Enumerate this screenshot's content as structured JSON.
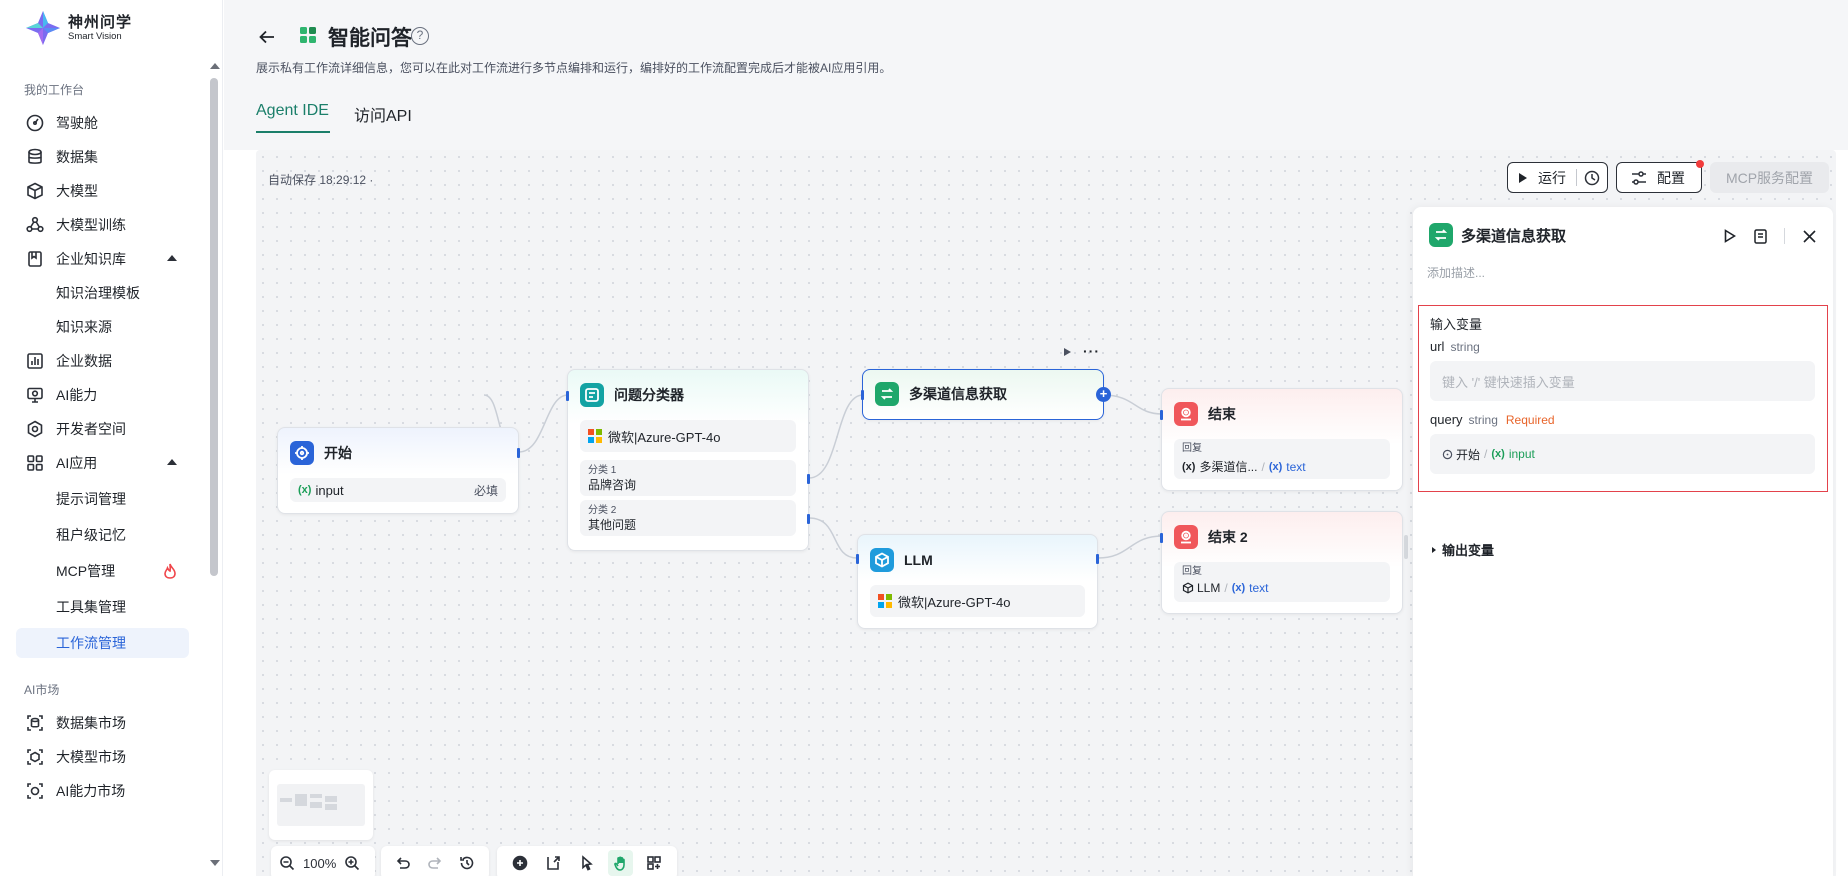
{
  "brand": {
    "name_cn": "神州问学",
    "name_en": "Smart Vision"
  },
  "sidebar": {
    "sections": [
      {
        "title": "我的工作台"
      },
      {
        "title": "AI市场"
      }
    ],
    "items": [
      {
        "label": "驾驶舱",
        "icon": "dashboard-icon"
      },
      {
        "label": "数据集",
        "icon": "database-icon"
      },
      {
        "label": "大模型",
        "icon": "cube-icon"
      },
      {
        "label": "大模型训练",
        "icon": "training-icon"
      },
      {
        "label": "企业知识库",
        "icon": "knowledge-icon",
        "expanded": true
      },
      {
        "label": "知识治理模板"
      },
      {
        "label": "知识来源"
      },
      {
        "label": "企业数据",
        "icon": "chart-icon"
      },
      {
        "label": "AI能力",
        "icon": "ai-ability-icon"
      },
      {
        "label": "开发者空间",
        "icon": "developer-icon"
      },
      {
        "label": "AI应用",
        "icon": "apps-icon",
        "expanded": true
      },
      {
        "label": "提示词管理"
      },
      {
        "label": "租户级记忆"
      },
      {
        "label": "MCP管理",
        "badge": "fire-icon"
      },
      {
        "label": "工具集管理"
      },
      {
        "label": "工作流管理",
        "active": true
      },
      {
        "label": "数据集市场",
        "icon": "dataset-market-icon"
      },
      {
        "label": "大模型市场",
        "icon": "model-market-icon"
      },
      {
        "label": "AI能力市场",
        "icon": "ability-market-icon"
      }
    ]
  },
  "header": {
    "title": "智能问答",
    "help": "?",
    "description": "展示私有工作流详细信息，您可以在此对工作流进行多节点编排和运行，编排好的工作流配置完成后才能被AI应用引用。",
    "tabs": [
      {
        "label": "Agent IDE",
        "active": true
      },
      {
        "label": "访问API",
        "active": false
      }
    ]
  },
  "canvas": {
    "autosave": "自动保存 18:29:12 ·",
    "run_label": "运行",
    "config_label": "配置",
    "mcp_label": "MCP服务配置",
    "zoom": "100%"
  },
  "nodes": {
    "start": {
      "title": "开始",
      "var_name": "input",
      "required": "必填"
    },
    "classifier": {
      "title": "问题分类器",
      "model": "微软|Azure-GPT-4o",
      "classes": [
        {
          "label": "分类 1",
          "value": "品牌咨询"
        },
        {
          "label": "分类 2",
          "value": "其他问题"
        }
      ]
    },
    "multichannel": {
      "title": "多渠道信息获取"
    },
    "llm": {
      "title": "LLM",
      "model": "微软|Azure-GPT-4o"
    },
    "end1": {
      "title": "结束",
      "reply_label": "回复",
      "source": "多渠道信...",
      "var": "text"
    },
    "end2": {
      "title": "结束 2",
      "reply_label": "回复",
      "source": "LLM",
      "var": "text"
    }
  },
  "panel": {
    "title": "多渠道信息获取",
    "description_placeholder": "添加描述...",
    "inputs_title": "输入变量",
    "vars": [
      {
        "name": "url",
        "type": "string",
        "placeholder": "键入 '/' 键快速插入变量"
      },
      {
        "name": "query",
        "type": "string",
        "required": "Required",
        "source": "开始",
        "source_var": "input"
      }
    ],
    "outputs_title": "输出变量"
  },
  "colors": {
    "accent": "#1b7f6a",
    "link_blue": "#2a64d8",
    "start_icon": "#2a64d8",
    "classifier_icon": "#13a3a3",
    "multichannel_icon": "#1fa76b",
    "llm_icon": "#1f9bdc",
    "end_icon": "#f0575b",
    "highlight_border": "#e3424b"
  }
}
